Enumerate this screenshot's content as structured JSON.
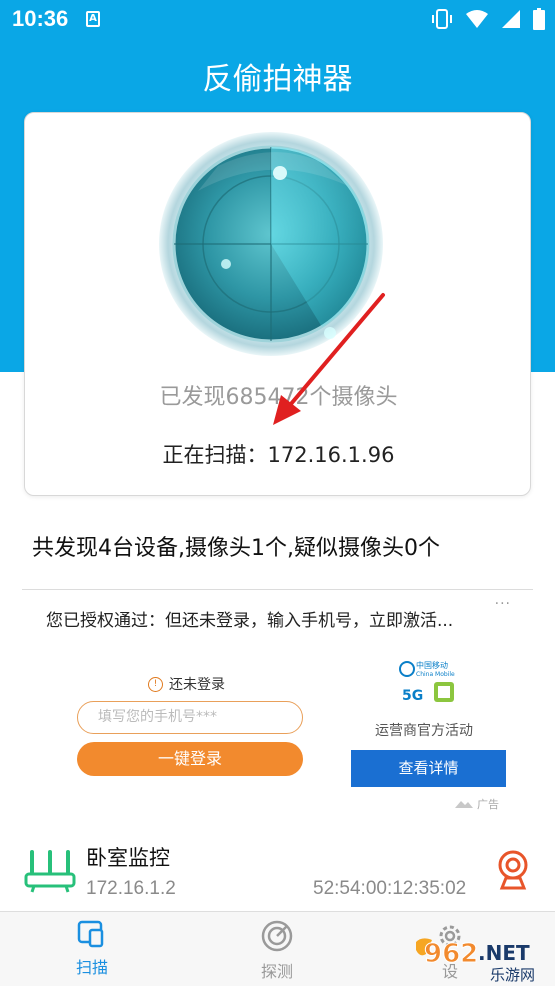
{
  "status_bar": {
    "time": "10:36",
    "notif_letter": "A"
  },
  "app": {
    "title": "反偷拍神器"
  },
  "scanner": {
    "found_text": "已发现685472个摄像头",
    "scanning_label": "正在扫描：",
    "scanning_ip": "172.16.1.96"
  },
  "summary": "共发现4台设备,摄像头1个,疑似摄像头0个",
  "ad": {
    "headline": "您已授权通过：但还未登录，输入手机号，立即激活...",
    "more": "···",
    "login_status": "还未登录",
    "phone_placeholder": "填写您的手机号***",
    "login_button": "一键登录",
    "logo_line1": "中国移动",
    "logo_line2": "China Mobile",
    "operator_text": "运营商官方活动",
    "details_button": "查看详情",
    "ad_label": "广告"
  },
  "devices": [
    {
      "name": "卧室监控",
      "ip": "172.16.1.2",
      "mac": "52:54:00:12:35:02"
    }
  ],
  "nav": {
    "scan": "扫描",
    "probe": "探测",
    "third": "设"
  },
  "watermark": {
    "brand": "962",
    "suffix": ".NET",
    "sub": "乐游网"
  },
  "colors": {
    "primary": "#0aa7e6",
    "accent_orange": "#f28a2e",
    "button_blue": "#1a6fd2",
    "active_nav": "#1a8fe0",
    "arrow": "#e02020"
  }
}
